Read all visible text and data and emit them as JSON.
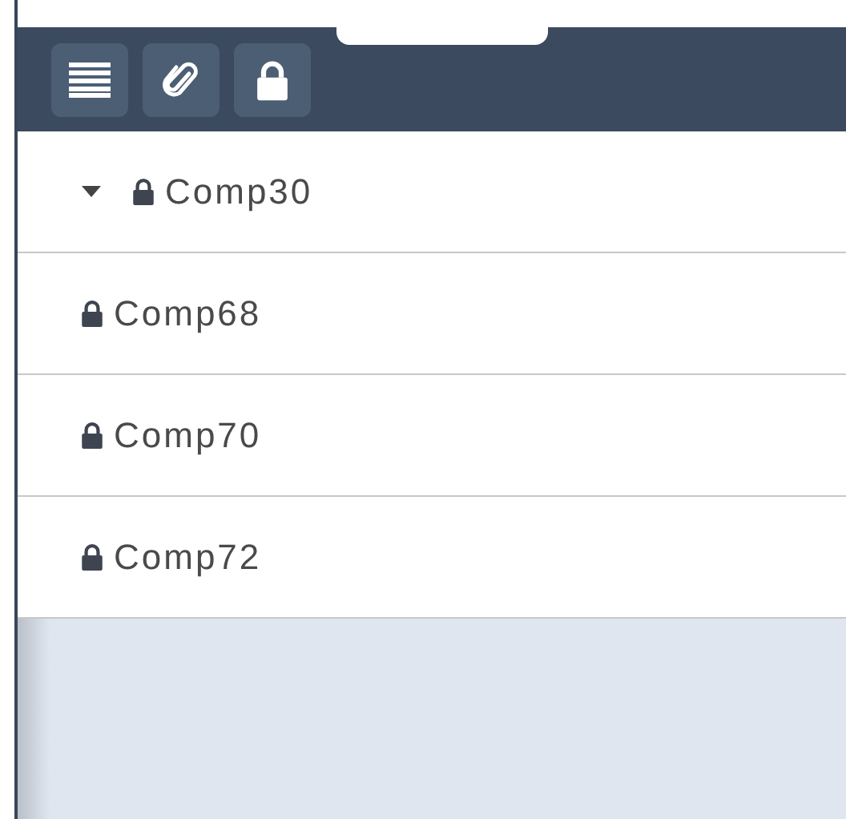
{
  "toolbar": {
    "buttons": [
      {
        "kind": "list"
      },
      {
        "kind": "attach"
      },
      {
        "kind": "lock"
      }
    ]
  },
  "items": [
    {
      "label": "Comp30",
      "kind": "group",
      "expanded": true,
      "locked": true
    },
    {
      "label": "Comp68",
      "kind": "leaf",
      "locked": true
    },
    {
      "label": "Comp70",
      "kind": "leaf",
      "locked": true
    },
    {
      "label": "Comp72",
      "kind": "leaf",
      "locked": true
    }
  ]
}
